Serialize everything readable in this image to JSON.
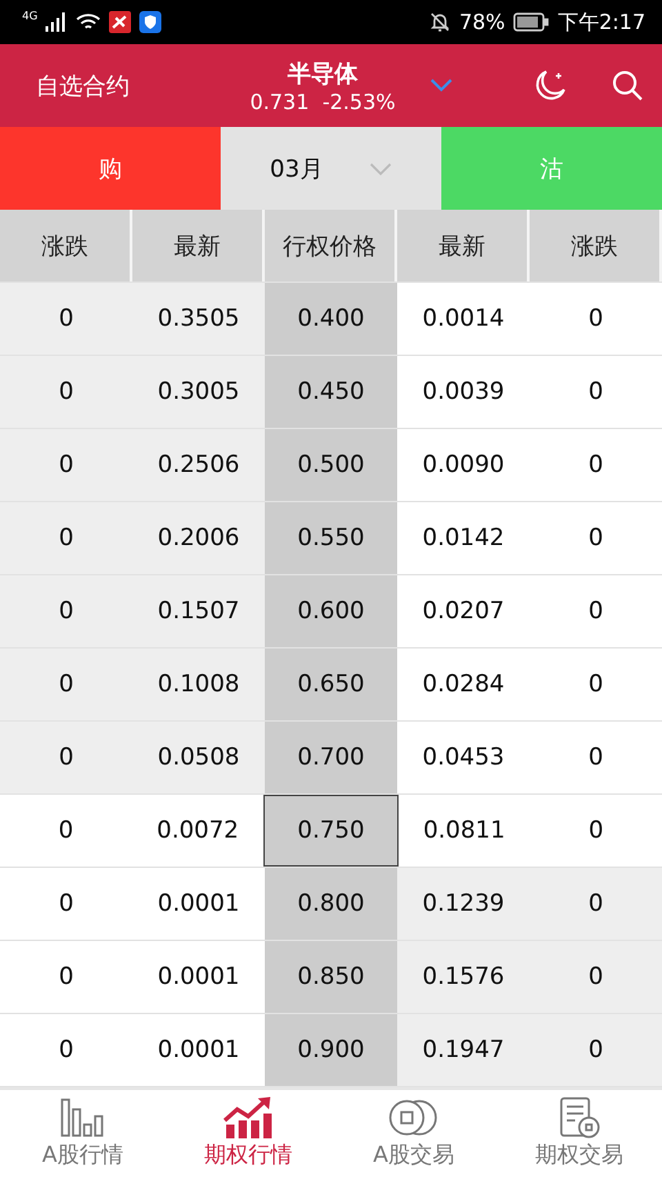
{
  "status_bar": {
    "network": "4G",
    "battery": "78%",
    "time": "下午2:17"
  },
  "header": {
    "left_link": "自选合约",
    "title": "半导体",
    "price": "0.731",
    "change": "-2.53%"
  },
  "option_bar": {
    "call_label": "购",
    "month": "03月",
    "put_label": "沽"
  },
  "table": {
    "columns": [
      "涨跌",
      "最新",
      "行权价格",
      "最新",
      "涨跌"
    ],
    "rows": [
      {
        "kind": "call_itm",
        "cells": [
          "0",
          "0.3505",
          "0.400",
          "0.0014",
          "0"
        ]
      },
      {
        "kind": "call_itm",
        "cells": [
          "0",
          "0.3005",
          "0.450",
          "0.0039",
          "0"
        ]
      },
      {
        "kind": "call_itm",
        "cells": [
          "0",
          "0.2506",
          "0.500",
          "0.0090",
          "0"
        ]
      },
      {
        "kind": "call_itm",
        "cells": [
          "0",
          "0.2006",
          "0.550",
          "0.0142",
          "0"
        ]
      },
      {
        "kind": "call_itm",
        "cells": [
          "0",
          "0.1507",
          "0.600",
          "0.0207",
          "0"
        ]
      },
      {
        "kind": "call_itm",
        "cells": [
          "0",
          "0.1008",
          "0.650",
          "0.0284",
          "0"
        ]
      },
      {
        "kind": "call_itm",
        "cells": [
          "0",
          "0.0508",
          "0.700",
          "0.0453",
          "0"
        ]
      },
      {
        "kind": "atm",
        "cells": [
          "0",
          "0.0072",
          "0.750",
          "0.0811",
          "0"
        ]
      },
      {
        "kind": "put_itm",
        "cells": [
          "0",
          "0.0001",
          "0.800",
          "0.1239",
          "0"
        ]
      },
      {
        "kind": "put_itm",
        "cells": [
          "0",
          "0.0001",
          "0.850",
          "0.1576",
          "0"
        ]
      },
      {
        "kind": "put_itm",
        "cells": [
          "0",
          "0.0001",
          "0.900",
          "0.1947",
          "0"
        ]
      }
    ]
  },
  "bottom_nav": [
    {
      "label": "A股行情",
      "kind": "bars",
      "selected": false
    },
    {
      "label": "期权行情",
      "kind": "trend",
      "selected": true
    },
    {
      "label": "A股交易",
      "kind": "coins",
      "selected": false
    },
    {
      "label": "期权交易",
      "kind": "doc",
      "selected": false
    }
  ]
}
